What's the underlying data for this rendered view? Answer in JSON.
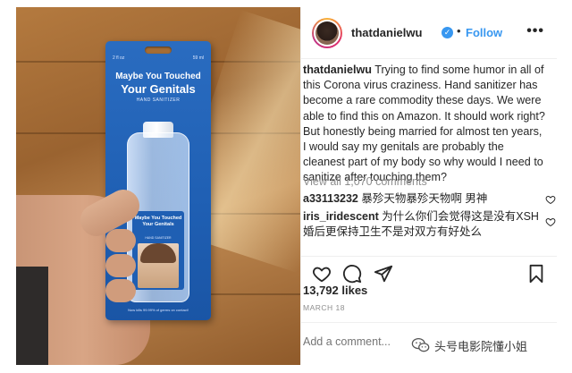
{
  "photo": {
    "card_size_left": "2 fl oz",
    "card_size_right": "59 ml",
    "card_line1": "Maybe You Touched",
    "card_line2": "Your Genitals",
    "card_line3": "HAND SANITIZER",
    "label_line1": "Maybe You Touched Your Genitals",
    "label_line2": "HAND SANITIZER",
    "card_footer": "Now kills 99.99% of germs on contact!"
  },
  "header": {
    "username": "thatdanielwu",
    "verified_icon": "verified-badge-icon",
    "separator": "•",
    "follow_label": "Follow",
    "more_label": "•••"
  },
  "caption": {
    "username": "thatdanielwu",
    "text": "Trying to find some humor in all of this Corona virus craziness. Hand sanitizer has become a rare commodity these days. We were able to find this on Amazon. It should work right? But honestly being married for almost ten years, I would say my genitals are probably the cleanest part of my body so why would I need to sanitize after touching them?"
  },
  "comments": {
    "view_all_label": "View all 1,070 comments",
    "items": [
      {
        "username": "a33113232",
        "text": "暴殄天物暴殄天物啊 男神"
      },
      {
        "username": "iris_iridescent",
        "text": "为什么你们会觉得这是没有XSH婚后更保持卫生不是对双方有好处么"
      }
    ]
  },
  "actions": {
    "like_icon": "heart-icon",
    "comment_icon": "comment-bubble-icon",
    "share_icon": "paper-plane-icon",
    "save_icon": "bookmark-icon"
  },
  "likes_label": "13,792 likes",
  "date_label": "MARCH 18",
  "add_comment_placeholder": "Add a comment...",
  "watermark": {
    "text": "头号电影院懂小姐",
    "logo_icon": "wechat-icon"
  },
  "colors": {
    "link_blue": "#3897f0",
    "text_dark": "#262626",
    "text_gray": "#8e8e8e",
    "divider": "#efefef"
  }
}
